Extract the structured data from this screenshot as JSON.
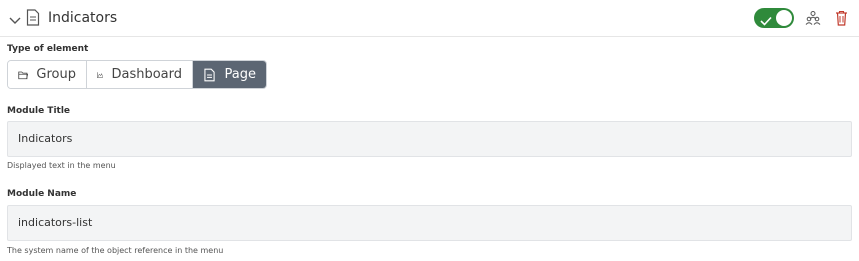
{
  "header": {
    "title": "Indicators",
    "enabled": true,
    "icons": [
      "chevron-down-icon",
      "document-icon",
      "check-icon",
      "people-icon",
      "trash-icon"
    ],
    "accent": "#2f8a3b",
    "danger": "#c0392b"
  },
  "type_of_element": {
    "label": "Type of element",
    "options": [
      {
        "label": "Group",
        "icon": "folder-icon",
        "selected": false
      },
      {
        "label": "Dashboard",
        "icon": "chart-icon",
        "selected": false
      },
      {
        "label": "Page",
        "icon": "document-icon",
        "selected": true
      }
    ],
    "selected_color": "#5c6673"
  },
  "module_title": {
    "label": "Module Title",
    "value": "Indicators",
    "hint": "Displayed text in the menu"
  },
  "module_name": {
    "label": "Module Name",
    "value": "indicators-list",
    "hint": "The system name of the object reference in the menu"
  }
}
